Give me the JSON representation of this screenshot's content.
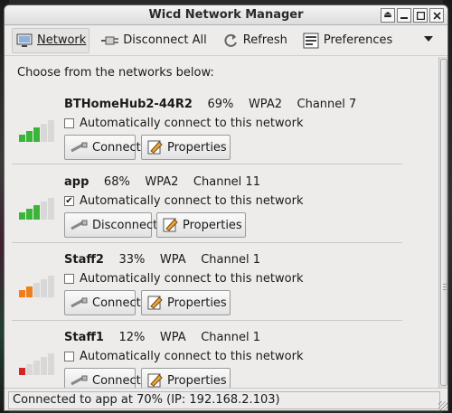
{
  "window": {
    "title": "Wicd Network Manager"
  },
  "toolbar": {
    "network": "Network",
    "disconnect_all": "Disconnect All",
    "refresh": "Refresh",
    "preferences": "Preferences"
  },
  "intro": "Choose from the networks below:",
  "colors": {
    "strong": "#3ab53a",
    "medium": "#ef7d1d",
    "weak": "#d62525",
    "empty": "#d8d8d8"
  },
  "networks": [
    {
      "name": "BTHomeHub2-44R2",
      "strength": "69%",
      "encryption": "WPA2",
      "channel": "Channel 7",
      "auto_label": "Automatically connect to this network",
      "auto_checked": false,
      "action_label": "Connect",
      "properties_label": "Properties",
      "signal_level": 0.69,
      "signal_color": "#3ab53a"
    },
    {
      "name": "app",
      "strength": "68%",
      "encryption": "WPA2",
      "channel": "Channel 11",
      "auto_label": "Automatically connect to this network",
      "auto_checked": true,
      "action_label": "Disconnect",
      "properties_label": "Properties",
      "signal_level": 0.68,
      "signal_color": "#3ab53a"
    },
    {
      "name": "Staff2",
      "strength": "33%",
      "encryption": "WPA",
      "channel": "Channel 1",
      "auto_label": "Automatically connect to this network",
      "auto_checked": false,
      "action_label": "Connect",
      "properties_label": "Properties",
      "signal_level": 0.33,
      "signal_color": "#ef7d1d"
    },
    {
      "name": "Staff1",
      "strength": "12%",
      "encryption": "WPA",
      "channel": "Channel 1",
      "auto_label": "Automatically connect to this network",
      "auto_checked": false,
      "action_label": "Connect",
      "properties_label": "Properties",
      "signal_level": 0.12,
      "signal_color": "#d62525"
    }
  ],
  "status": "Connected to app at 70% (IP: 192.168.2.103)"
}
